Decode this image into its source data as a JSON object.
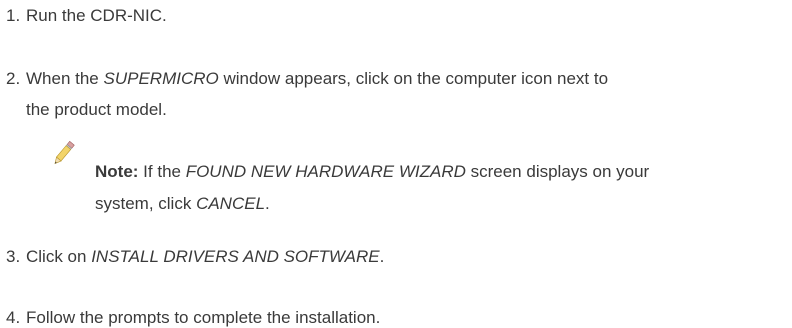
{
  "steps": [
    {
      "number": "1.",
      "text": "Run the CDR-NIC."
    },
    {
      "number": "2.",
      "pre": "When the ",
      "em": "SUPERMICRO",
      "post": " window appears, click on the computer icon next to",
      "line2": "the product model."
    },
    {
      "number": "3.",
      "pre": "Click on ",
      "em": "INSTALL DRIVERS AND SOFTWARE",
      "post": "."
    },
    {
      "number": "4.",
      "text": "Follow the prompts to complete the installation."
    }
  ],
  "note": {
    "icon": "pencil-icon",
    "label": "Note:",
    "pre": " If the ",
    "em": "FOUND NEW HARDWARE WIZARD",
    "post": " screen displays on your",
    "line2_pre": "system, click ",
    "line2_em": "CANCEL",
    "line2_post": "."
  }
}
